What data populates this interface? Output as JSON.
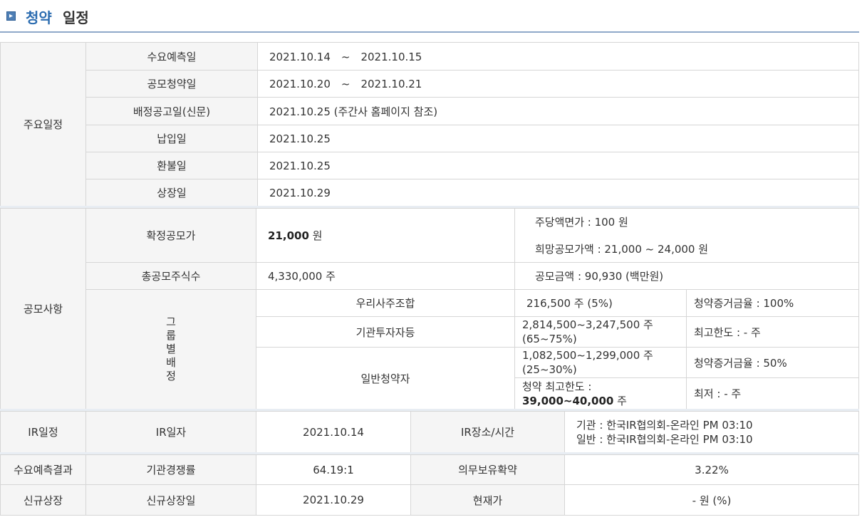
{
  "title": {
    "part1": "청약",
    "part2": "일정"
  },
  "schedule": {
    "category": "주요일정",
    "rows": [
      {
        "label": "수요예측일",
        "value": "2021.10.14　~　2021.10.15"
      },
      {
        "label": "공모청약일",
        "value": "2021.10.20　~　2021.10.21"
      },
      {
        "label": "배정공고일(신문)",
        "value": "2021.10.25 (주간사 홈페이지 참조)"
      },
      {
        "label": "납입일",
        "value": "2021.10.25"
      },
      {
        "label": "환불일",
        "value": "2021.10.25"
      },
      {
        "label": "상장일",
        "value": "2021.10.29"
      }
    ]
  },
  "offering": {
    "category": "공모사항",
    "final_price_label": "확정공모가",
    "final_price_value": "21,000",
    "final_price_unit": "원",
    "par_value": "주당액면가 :  100 원",
    "desired_price": "희망공모가액 :  21,000 ~ 24,000 원",
    "total_shares_label": "총공모주식수",
    "total_shares_value": "4,330,000 주",
    "amount": "공모금액 :  90,930 (백만원)",
    "group_label": [
      "그",
      "룹",
      "별",
      "배",
      "정"
    ],
    "groups": [
      {
        "name": "우리사주조합",
        "shares": "216,500 주  (5%)",
        "note": "청약증거금율 : 100%"
      },
      {
        "name": "기관투자자등",
        "shares": "2,814,500~3,247,500 주",
        "shares2": "(65~75%)",
        "note": "최고한도 :  - 주"
      },
      {
        "name": "일반청약자",
        "shares": "1,082,500~1,299,000 주",
        "shares2": "(25~30%)",
        "note": "청약증거금율 : 50%",
        "limit_label": "청약 최고한도 :",
        "limit_value": "39,000~40,000",
        "limit_unit": "주",
        "note2": "최저 :  - 주"
      }
    ]
  },
  "ir": {
    "category": "IR일정",
    "date_label": "IR일자",
    "date_value": "2021.10.14",
    "place_label": "IR장소/시간",
    "place_line1": "기관 : 한국IR협의회-온라인 PM 03:10",
    "place_line2": "일반 : 한국IR협의회-온라인 PM 03:10"
  },
  "demand": {
    "category": "수요예측결과",
    "comp_label": "기관경쟁률",
    "comp_value": "64.19:1",
    "lock_label": "의무보유확약",
    "lock_value": "3.22%"
  },
  "listing": {
    "category": "신규상장",
    "date_label": "신규상장일",
    "date_value": "2021.10.29",
    "price_label": "현재가",
    "price_value": "- 원 (%)"
  }
}
